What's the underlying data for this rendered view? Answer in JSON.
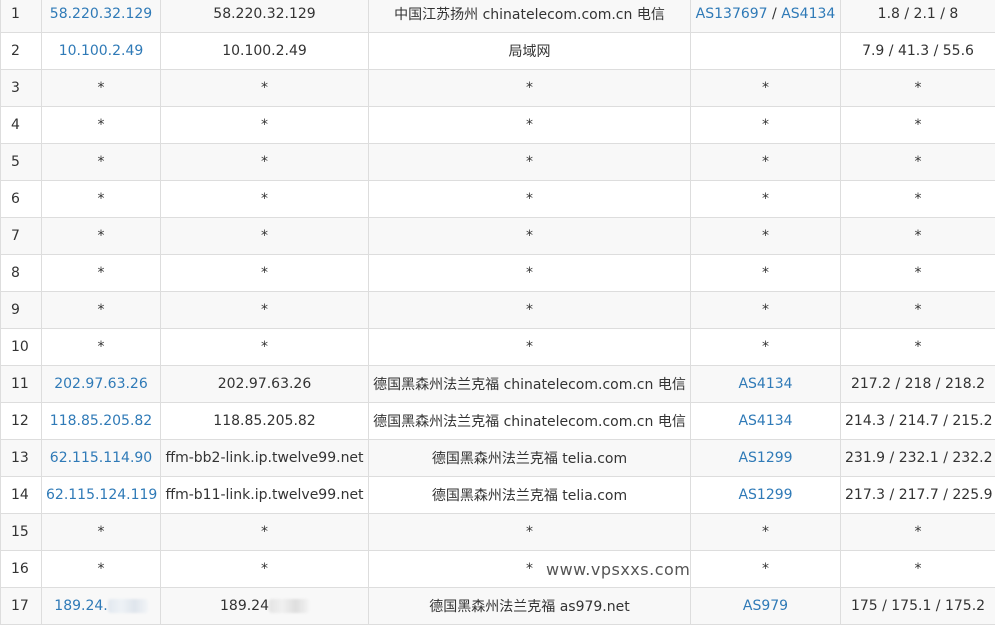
{
  "watermark": "www.vpsxxs.com",
  "hops": [
    {
      "hop": "1",
      "ip": "58.220.32.129",
      "host": "58.220.32.129",
      "location": "中国江苏扬州 chinatelecom.com.cn 电信",
      "as": [
        "AS137697",
        "AS4134"
      ],
      "times": "1.8 / 2.1 / 8"
    },
    {
      "hop": "2",
      "ip": "10.100.2.49",
      "host": "10.100.2.49",
      "location": "局域网",
      "as": [],
      "times": "7.9 / 41.3 / 55.6"
    },
    {
      "hop": "3",
      "ip": "*",
      "host": "*",
      "location": "*",
      "as": [
        "*"
      ],
      "times": "*"
    },
    {
      "hop": "4",
      "ip": "*",
      "host": "*",
      "location": "*",
      "as": [
        "*"
      ],
      "times": "*"
    },
    {
      "hop": "5",
      "ip": "*",
      "host": "*",
      "location": "*",
      "as": [
        "*"
      ],
      "times": "*"
    },
    {
      "hop": "6",
      "ip": "*",
      "host": "*",
      "location": "*",
      "as": [
        "*"
      ],
      "times": "*"
    },
    {
      "hop": "7",
      "ip": "*",
      "host": "*",
      "location": "*",
      "as": [
        "*"
      ],
      "times": "*"
    },
    {
      "hop": "8",
      "ip": "*",
      "host": "*",
      "location": "*",
      "as": [
        "*"
      ],
      "times": "*"
    },
    {
      "hop": "9",
      "ip": "*",
      "host": "*",
      "location": "*",
      "as": [
        "*"
      ],
      "times": "*"
    },
    {
      "hop": "10",
      "ip": "*",
      "host": "*",
      "location": "*",
      "as": [
        "*"
      ],
      "times": "*"
    },
    {
      "hop": "11",
      "ip": "202.97.63.26",
      "host": "202.97.63.26",
      "location": "德国黑森州法兰克福 chinatelecom.com.cn 电信",
      "as": [
        "AS4134"
      ],
      "times": "217.2 / 218 / 218.2"
    },
    {
      "hop": "12",
      "ip": "118.85.205.82",
      "host": "118.85.205.82",
      "location": "德国黑森州法兰克福 chinatelecom.com.cn 电信",
      "as": [
        "AS4134"
      ],
      "times": "214.3 / 214.7 / 215.2"
    },
    {
      "hop": "13",
      "ip": "62.115.114.90",
      "host": "ffm-bb2-link.ip.twelve99.net",
      "location": "德国黑森州法兰克福 telia.com",
      "as": [
        "AS1299"
      ],
      "times": "231.9 / 232.1 / 232.2"
    },
    {
      "hop": "14",
      "ip": "62.115.124.119",
      "host": "ffm-b11-link.ip.twelve99.net",
      "location": "德国黑森州法兰克福 telia.com",
      "as": [
        "AS1299"
      ],
      "times": "217.3 / 217.7 / 225.9"
    },
    {
      "hop": "15",
      "ip": "*",
      "host": "*",
      "location": "*",
      "as": [
        "*"
      ],
      "times": "*"
    },
    {
      "hop": "16",
      "ip": "*",
      "host": "*",
      "location": "*",
      "as": [
        "*"
      ],
      "times": "*"
    },
    {
      "hop": "17",
      "ip": "189.24.",
      "host": "189.24",
      "location": "德国黑森州法兰克福 as979.net",
      "as": [
        "AS979"
      ],
      "times": "175 / 175.1 / 175.2",
      "masked": true
    }
  ]
}
